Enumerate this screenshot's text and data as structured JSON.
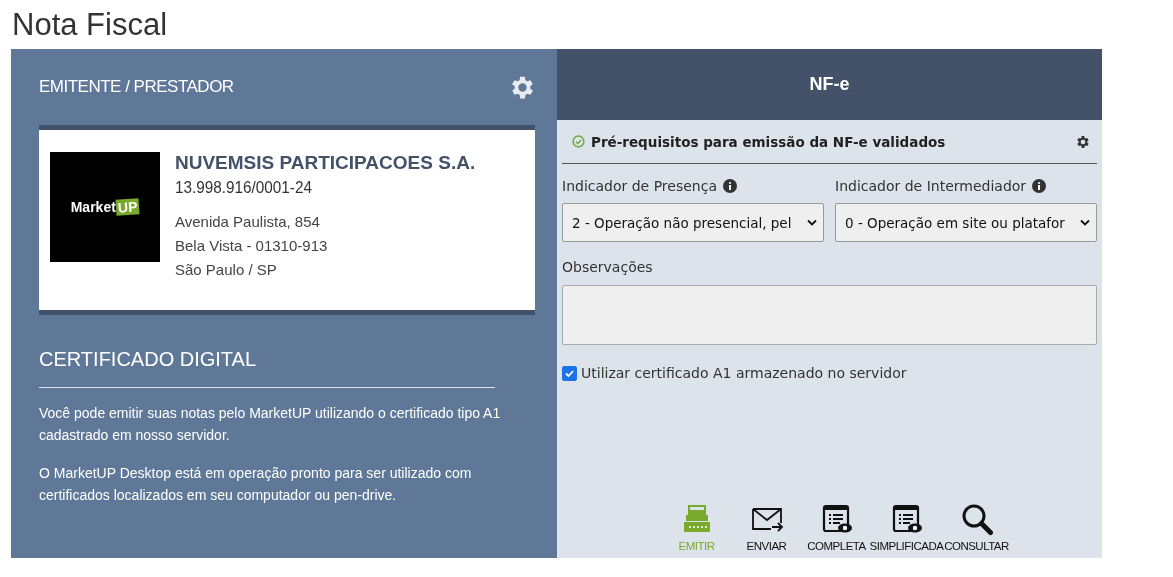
{
  "page_title": "Nota Fiscal",
  "issuer": {
    "heading": "EMITENTE / PRESTADOR",
    "logo": {
      "text": "Market",
      "badge": "UP"
    },
    "name": "NUVEMSIS PARTICIPACOES S.A.",
    "tax_id": "13.998.916/0001-24",
    "address": [
      "Avenida Paulista, 854",
      "Bela Vista - 01310-913",
      "São Paulo / SP"
    ]
  },
  "certificate": {
    "heading": "CERTIFICADO DIGITAL",
    "paragraphs": [
      "Você pode emitir suas notas pelo MarketUP utilizando o certificado tipo A1 cadastrado em nosso servidor.",
      "O MarketUP Desktop está em operação pronto para ser utilizado com certificados localizados em seu computador ou pen-drive."
    ]
  },
  "nfe": {
    "title": "NF-e",
    "status": {
      "text": "Pré-requisitos para emissão da NF-e validados",
      "validated": true
    },
    "selects": [
      {
        "label": "Indicador de Presença",
        "value": "2 - Operação não presencial, pel"
      },
      {
        "label": "Indicador de Intermediador",
        "value": "0 - Operação em site ou platafor"
      }
    ],
    "notes_label": "Observações",
    "use_server_certificate": {
      "label": "Utilizar certificado A1 armazenado no servidor",
      "checked": true
    },
    "actions": [
      {
        "kind": "print",
        "label": "EMITIR",
        "active": true
      },
      {
        "kind": "send",
        "label": "ENVIAR",
        "active": false
      },
      {
        "kind": "preview",
        "label": "COMPLETA",
        "active": false
      },
      {
        "kind": "preview",
        "label": "SIMPLIFICADA",
        "active": false
      },
      {
        "kind": "search",
        "label": "CONSULTAR",
        "active": false
      }
    ]
  }
}
